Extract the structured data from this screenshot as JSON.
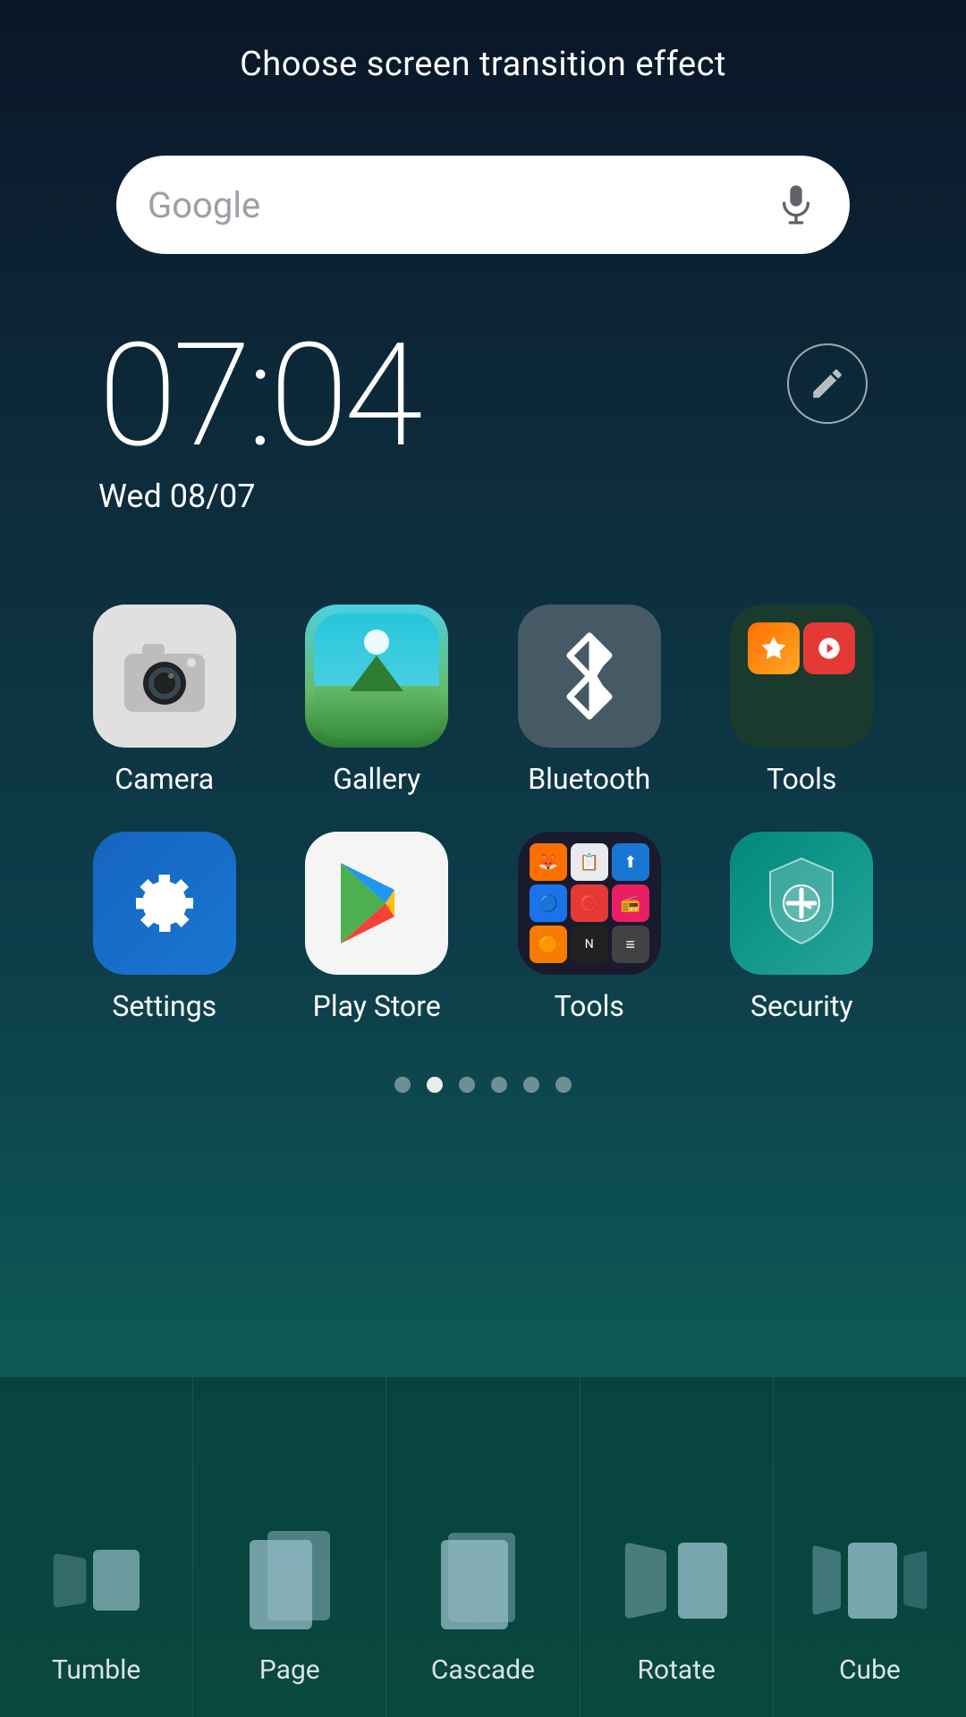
{
  "header": {
    "title": "Choose screen transition effect"
  },
  "search": {
    "placeholder": "Google",
    "mic_label": "microphone"
  },
  "clock": {
    "time": "07:04",
    "date": "Wed 08/07",
    "hour": "07",
    "minutes": ":04"
  },
  "apps_row1": [
    {
      "id": "camera",
      "label": "Camera",
      "icon_type": "camera"
    },
    {
      "id": "gallery",
      "label": "Gallery",
      "icon_type": "gallery"
    },
    {
      "id": "bluetooth",
      "label": "Bluetooth",
      "icon_type": "bluetooth"
    },
    {
      "id": "tools-folder",
      "label": "Tools",
      "icon_type": "tools-folder"
    }
  ],
  "apps_row2": [
    {
      "id": "settings",
      "label": "Settings",
      "icon_type": "settings"
    },
    {
      "id": "playstore",
      "label": "Play Store",
      "icon_type": "playstore"
    },
    {
      "id": "tools-app",
      "label": "Tools",
      "icon_type": "tools-app"
    },
    {
      "id": "security",
      "label": "Security",
      "icon_type": "security"
    }
  ],
  "page_indicators": {
    "total": 6,
    "active": 1
  },
  "transitions": [
    {
      "id": "tumble",
      "label": "Tumble",
      "shape": "tumble"
    },
    {
      "id": "page",
      "label": "Page",
      "shape": "page"
    },
    {
      "id": "cascade",
      "label": "Cascade",
      "shape": "cascade"
    },
    {
      "id": "rotate",
      "label": "Rotate",
      "shape": "rotate"
    },
    {
      "id": "cube",
      "label": "Cube",
      "shape": "cube"
    }
  ],
  "colors": {
    "bg_top": "#0a1628",
    "bg_mid": "#0d3d4a",
    "bg_bot": "#0d6055",
    "accent": "#4dd0e1"
  }
}
